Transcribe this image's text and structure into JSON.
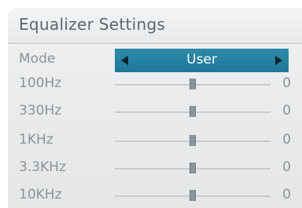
{
  "window": {
    "title": "Equalizer Settings"
  },
  "mode": {
    "label": "Mode",
    "value": "User"
  },
  "bands": [
    {
      "label": "100Hz",
      "value": "0",
      "level": 0.5
    },
    {
      "label": "330Hz",
      "value": "0",
      "level": 0.5
    },
    {
      "label": "1KHz",
      "value": "0",
      "level": 0.5
    },
    {
      "label": "3.3KHz",
      "value": "0",
      "level": 0.5
    },
    {
      "label": "10KHz",
      "value": "0",
      "level": 0.5
    }
  ],
  "colors": {
    "accent": "#2485a3",
    "text": "#8a9398",
    "title": "#5a6770"
  }
}
